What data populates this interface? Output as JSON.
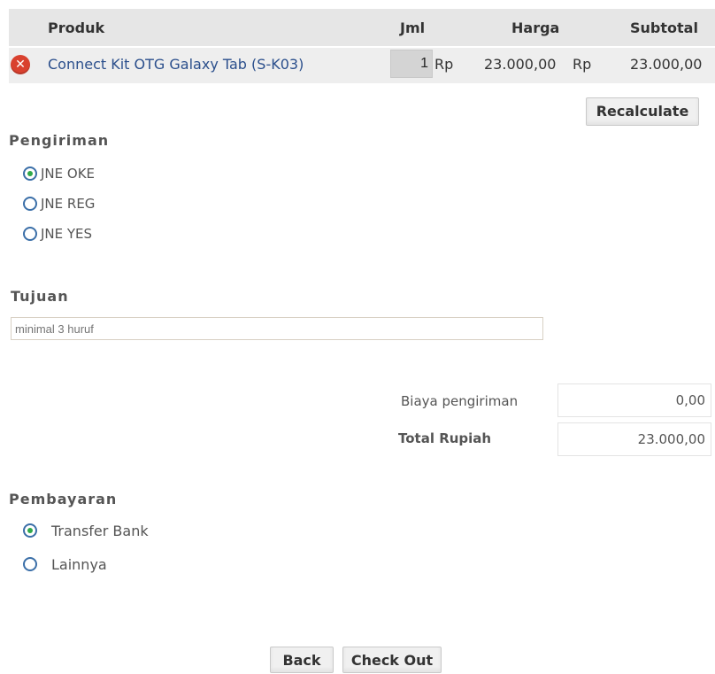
{
  "cart": {
    "headers": {
      "product": "Produk",
      "qty": "Jml",
      "price": "Harga",
      "subtotal": "Subtotal"
    },
    "rows": [
      {
        "product": "Connect Kit OTG Galaxy Tab (S-K03)",
        "qty": "1",
        "currency": "Rp",
        "price": "23.000,00",
        "currency2": "Rp",
        "subtotal": "23.000,00"
      }
    ],
    "recalculate_label": "Recalculate"
  },
  "shipping": {
    "title": "Pengiriman",
    "options": [
      {
        "label": "JNE OKE",
        "checked": true
      },
      {
        "label": "JNE REG",
        "checked": false
      },
      {
        "label": "JNE YES",
        "checked": false
      }
    ]
  },
  "destination": {
    "title": "Tujuan",
    "placeholder": "minimal 3 huruf"
  },
  "summary": {
    "shipping_cost_label": "Biaya pengiriman",
    "shipping_cost": "0,00",
    "total_label": "Total Rupiah",
    "total": "23.000,00"
  },
  "payment": {
    "title": "Pembayaran",
    "options": [
      {
        "label": "Transfer Bank",
        "checked": true
      },
      {
        "label": "Lainnya",
        "checked": false
      }
    ]
  },
  "actions": {
    "back_label": "Back",
    "checkout_label": "Check Out"
  },
  "icons": {
    "remove": "remove-icon"
  }
}
